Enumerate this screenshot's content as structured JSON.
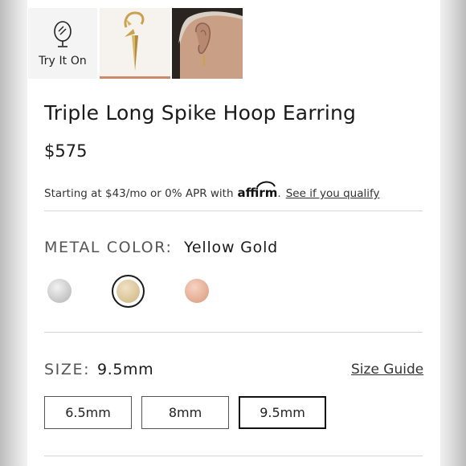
{
  "gallery": {
    "try_on_label": "Try It On"
  },
  "product": {
    "title": "Triple Long Spike Hoop Earring",
    "price": "$575"
  },
  "financing": {
    "text": "Starting at $43/mo or 0% APR with",
    "brand": "affirm",
    "separator": ".",
    "link": "See if you qualify"
  },
  "metal": {
    "label": "METAL COLOR:",
    "selected": "Yellow Gold",
    "options": [
      {
        "name": "silver",
        "color": "#c8c8c8"
      },
      {
        "name": "yellow-gold",
        "color": "#d7c294"
      },
      {
        "name": "rose-gold",
        "color": "#e3a98f"
      }
    ]
  },
  "size": {
    "label": "SIZE:",
    "selected": "9.5mm",
    "guide_link": "Size Guide",
    "options": [
      "6.5mm",
      "8mm",
      "9.5mm"
    ]
  },
  "colors": {
    "accent_underline": "#c98a6e",
    "divider": "#d4d4d4",
    "text": "#1a1a1a"
  }
}
